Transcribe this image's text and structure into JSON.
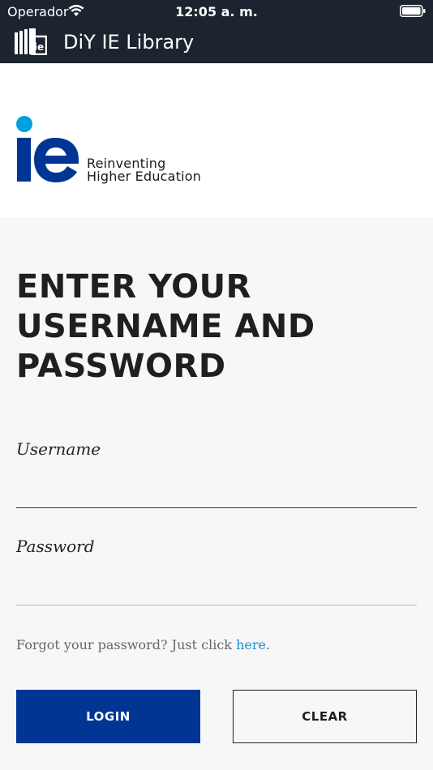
{
  "status_bar": {
    "carrier": "Operador",
    "time": "12:05 a. m."
  },
  "app_bar": {
    "title": "DiY IE Library",
    "logo_text": "ie"
  },
  "brand": {
    "tagline_line1": "Reinventing",
    "tagline_line2": "Higher Education",
    "logo_colors": {
      "dot": "#00a0e1",
      "letters": "#003594"
    }
  },
  "login": {
    "heading_line1": "ENTER YOUR",
    "heading_line2": "USERNAME AND",
    "heading_line3": "PASSWORD",
    "username_label": "Username",
    "username_value": "",
    "password_label": "Password",
    "password_value": "",
    "forgot_text": "Forgot your password? Just click",
    "forgot_link": "here",
    "forgot_suffix": ".",
    "login_button": "LOGIN",
    "clear_button": "CLEAR"
  },
  "colors": {
    "top_bar": "#1c2430",
    "accent": "#003594",
    "link": "#1a8fd0",
    "background": "#f7f7f7"
  }
}
